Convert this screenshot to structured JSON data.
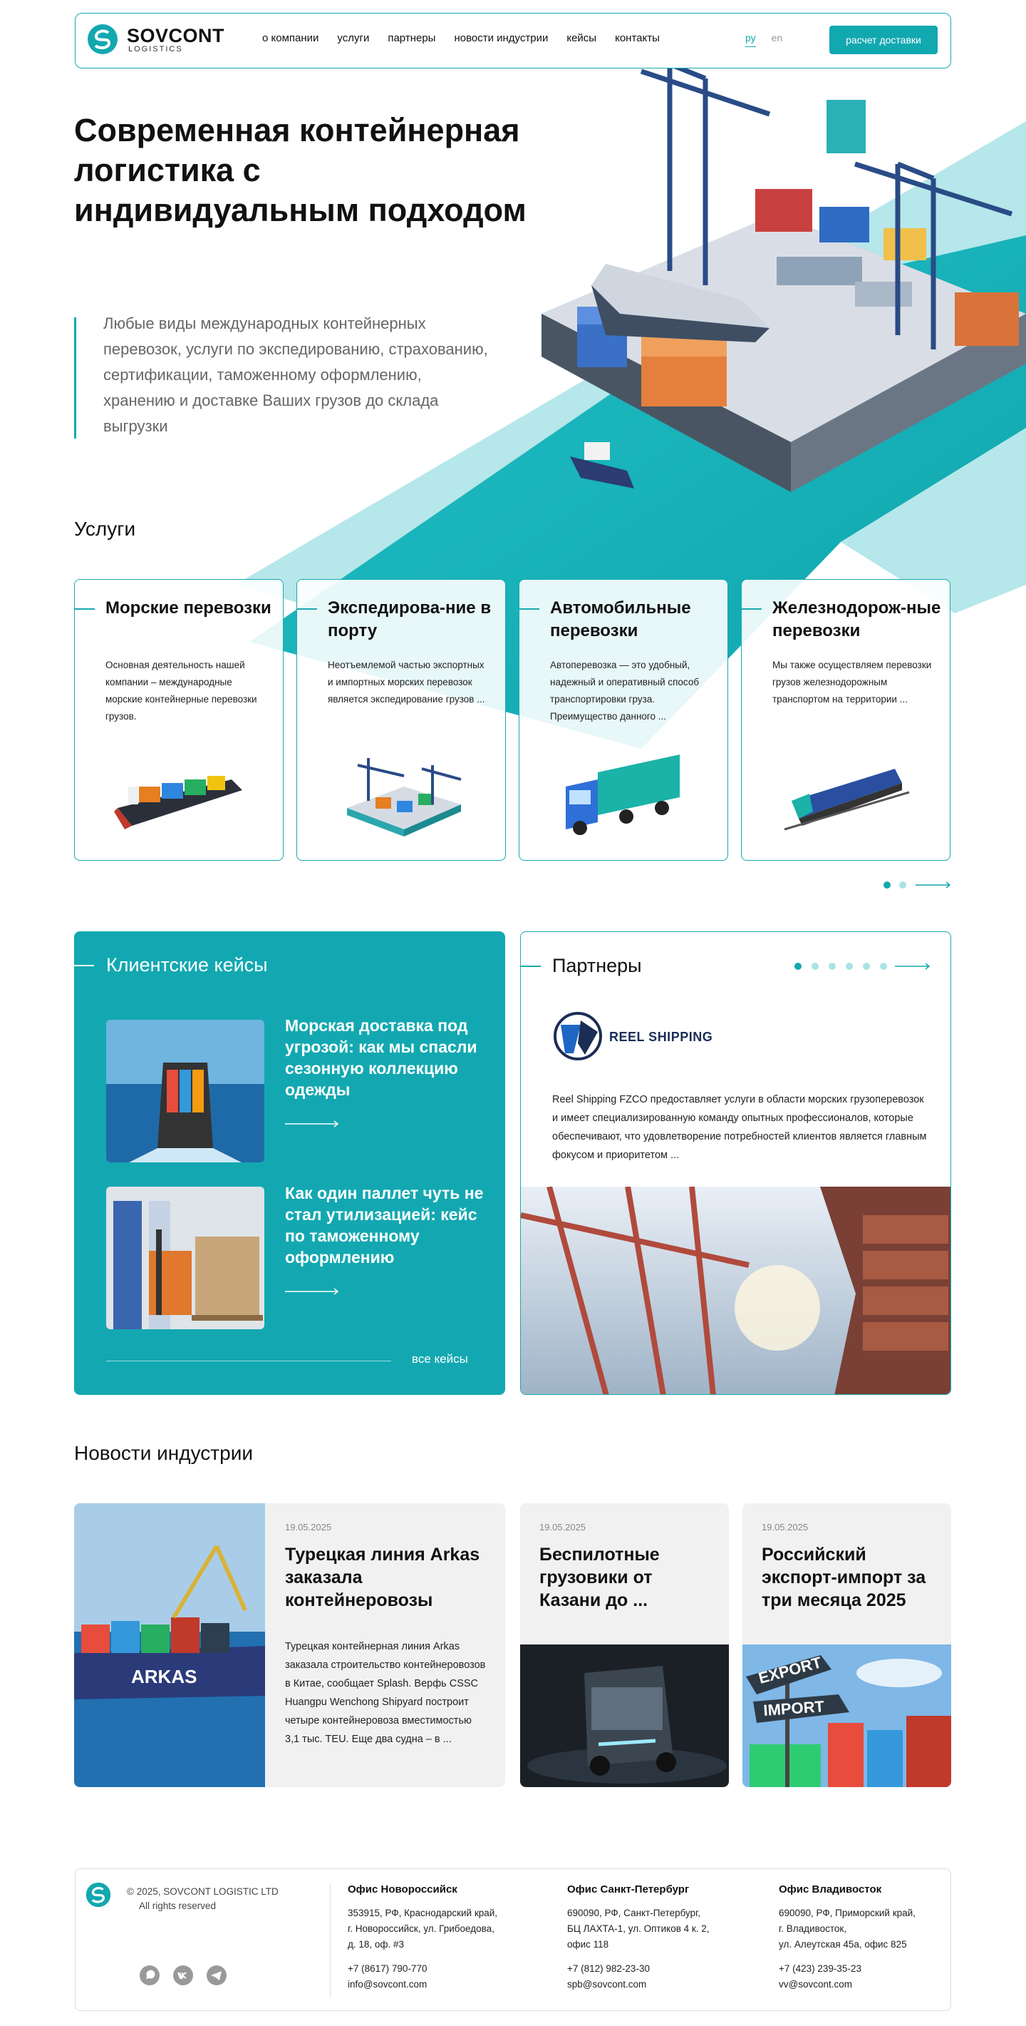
{
  "header": {
    "brand": "SOVCONT",
    "brand_sub": "LOGISTICS",
    "nav": [
      "о компании",
      "услуги",
      "партнеры",
      "новости индустрии",
      "кейсы",
      "контакты"
    ],
    "lang_active": "ру",
    "lang_other": "en",
    "cta": "расчет доставки"
  },
  "hero": {
    "title": "Современная контейнерная логистика с индивидуальным подходом",
    "text": "Любые виды международных контейнерных перевозок, услуги по экспедированию, страхованию, сертификации, таможенному оформлению, хранению и доставке Ваших грузов до склада выгрузки"
  },
  "services": {
    "title": "Услуги",
    "items": [
      {
        "title": "Морские перевозки",
        "text": "Основная деятельность нашей компании – международные морские контейнерные перевозки грузов."
      },
      {
        "title": "Экспедирова-ние в порту",
        "text": "Неотъемлемой частью экспортных и импортных морских перевозок является экспедирование грузов ..."
      },
      {
        "title": "Автомобильные перевозки",
        "text": "Автоперевозка — это удобный, надежный и оперативный способ транспортировки груза. Преимущество данного ..."
      },
      {
        "title": "Железнодорож-ные перевозки",
        "text": "Мы также осуществляем перевозки грузов железнодорожным транспортом на территории ..."
      }
    ]
  },
  "cases": {
    "title": "Клиентские кейсы",
    "items": [
      {
        "title": "Морская доставка под угрозой: как мы спасли сезонную коллекцию одежды"
      },
      {
        "title": "Как один паллет чуть не стал утилизацией: кейс по таможенному оформлению"
      }
    ],
    "all": "все кейсы"
  },
  "partners": {
    "title": "Партнеры",
    "logo_text": "REEL SHIPPING",
    "text": "Reel Shipping FZCO предоставляет услуги в области морских грузоперевозок и имеет специализированную команду опытных профессионалов, которые обеспечивают, что удовлетворение потребностей клиентов является главным фокусом и приоритетом ..."
  },
  "news": {
    "title": "Новости индустрии",
    "items": [
      {
        "date": "19.05.2025",
        "title": "Турецкая линия Arkas заказала контейнеровозы",
        "text": "Турецкая контейнерная линия Arkas заказала строительство контейнеровозов в Китае, сообщает Splash. Верфь CSSC Huangpu Wenchong Shipyard построит четыре контейнеровоза вместимостью 3,1 тыс. TEU. Еще два судна – в ...",
        "ship_label": "ARKAS"
      },
      {
        "date": "19.05.2025",
        "title": "Беспилотные грузовики от Казани до ..."
      },
      {
        "date": "19.05.2025",
        "title": "Российский экспорт-импорт за три месяца 2025",
        "sign1": "EXPORT",
        "sign2": "IMPORT"
      }
    ]
  },
  "footer": {
    "copy": "© 2025, SOVCONT LOGISTIC LTD",
    "rights": "All rights reserved",
    "offices": [
      {
        "title": "Офис Новороссийск",
        "lines": [
          "353915, РФ, Краснодарский край,",
          "г. Новороссийск, ул. Грибоедова,",
          "д. 18, оф. #3"
        ],
        "phone": "+7 (8617) 790-770",
        "email": "info@sovcont.com"
      },
      {
        "title": "Офис Санкт-Петербург",
        "lines": [
          "690090, РФ, Санкт-Петербург,",
          "БЦ ЛАХТА-1, ул. Оптиков 4 к. 2,",
          "офис 118"
        ],
        "phone": "+7 (812) 982-23-30",
        "email": "spb@sovcont.com"
      },
      {
        "title": "Офис Владивосток",
        "lines": [
          "690090, РФ, Приморский край,",
          "г. Владивосток,",
          "ул. Алеутская 45а, офис 825"
        ],
        "phone": "+7 (423) 239-35-23",
        "email": "vv@sovcont.com"
      }
    ]
  },
  "colors": {
    "accent": "#12a8b0",
    "accent_light": "#a8e3e6"
  }
}
